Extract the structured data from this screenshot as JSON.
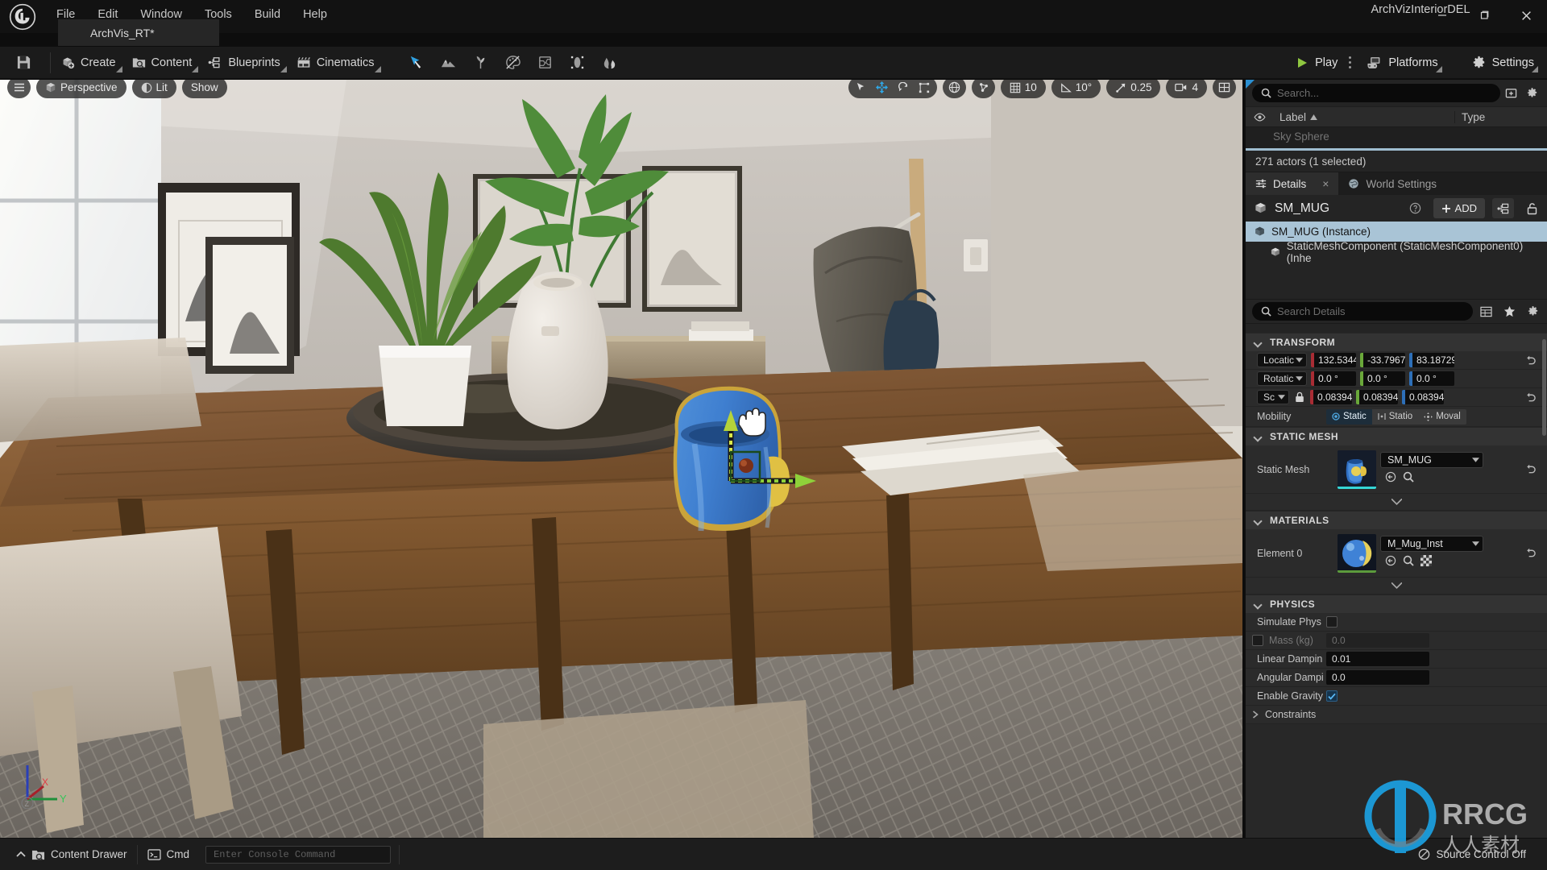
{
  "titlebar": {
    "logo_icon": "unreal-engine-logo",
    "menus": [
      "File",
      "Edit",
      "Window",
      "Tools",
      "Build",
      "Help"
    ],
    "project_tab": "ArchVis_RT*",
    "window_title": "ArchVizInteriorDEL",
    "minimize_icon": "minimize-icon",
    "maximize_icon": "restore-icon",
    "close_icon": "close-icon"
  },
  "toolbar": {
    "save_icon": "save-icon",
    "buttons": [
      {
        "label": "Create",
        "icon": "create-cube-plus-icon"
      },
      {
        "label": "Content",
        "icon": "content-folder-icon"
      },
      {
        "label": "Blueprints",
        "icon": "blueprints-node-icon"
      },
      {
        "label": "Cinematics",
        "icon": "cinematics-clapper-icon"
      }
    ],
    "modes": [
      {
        "name": "select-mode-icon",
        "active": true
      },
      {
        "name": "landscape-mode-icon",
        "active": false
      },
      {
        "name": "foliage-mode-icon",
        "active": false
      },
      {
        "name": "mesh-paint-mode-icon",
        "active": false
      },
      {
        "name": "fracture-mode-icon",
        "active": false
      },
      {
        "name": "brush-edit-mode-icon",
        "active": false
      },
      {
        "name": "animation-mode-icon",
        "active": false
      }
    ],
    "play_label": "Play",
    "play_icon": "play-triangle-icon",
    "platforms_label": "Platforms",
    "platforms_icon": "gamepad-icon",
    "settings_label": "Settings",
    "settings_icon": "gear-icon"
  },
  "viewport": {
    "menu_icon": "hamburger-icon",
    "perspective_label": "Perspective",
    "perspective_icon": "cube-icon",
    "lit_label": "Lit",
    "lit_icon": "lit-sphere-icon",
    "show_label": "Show",
    "gizmos": [
      {
        "name": "select-tool-icon",
        "active": false
      },
      {
        "name": "move-tool-icon",
        "active": true
      },
      {
        "name": "rotate-tool-icon",
        "active": false
      },
      {
        "name": "scale-tool-icon",
        "active": false
      }
    ],
    "coord_icon": "world-coordinate-icon",
    "surface_snap_icon": "surface-snap-icon",
    "grid_snap_value": "10",
    "grid_snap_icon": "grid-icon",
    "angle_snap_value": "10°",
    "angle_snap_icon": "angle-icon",
    "scale_snap_value": "0.25",
    "scale_snap_icon": "scale-arrow-icon",
    "camera_speed_value": "4",
    "camera_speed_icon": "camera-icon",
    "layout_icon": "viewport-layout-icon",
    "axis_gizmo": {
      "x": "X",
      "y": "Y",
      "z": "Z"
    },
    "cursor_icon": "hand-cursor"
  },
  "outliner": {
    "search_placeholder": "Search...",
    "add_icon": "add-folder-icon",
    "settings_icon": "gear-icon",
    "eye_icon": "eye-icon",
    "col_label": "Label",
    "col_type": "Type",
    "sort_icon": "sort-ascending-icon",
    "status": "271 actors (1 selected)"
  },
  "details": {
    "tabs": [
      {
        "label": "Details",
        "icon": "sliders-icon",
        "active": true,
        "closable": true
      },
      {
        "label": "World Settings",
        "icon": "globe-icon",
        "active": false,
        "closable": false
      }
    ],
    "close_icon": "close-icon",
    "actor_name": "SM_MUG",
    "actor_icon": "static-mesh-icon",
    "help_icon": "help-circle-icon",
    "add_label": "ADD",
    "add_icon": "plus-icon",
    "blueprint_icon": "blueprint-node-icon",
    "lock_icon": "unlock-icon",
    "components": [
      {
        "label": "SM_MUG (Instance)",
        "icon": "static-mesh-icon",
        "selected": true,
        "child": false
      },
      {
        "label": "StaticMeshComponent (StaticMeshComponent0) (Inhe",
        "icon": "static-mesh-icon",
        "selected": false,
        "child": true
      }
    ],
    "search_placeholder": "Search Details",
    "search_icon": "search-icon",
    "column_icon": "columns-icon",
    "favorite_icon": "star-icon",
    "gear_icon": "gear-icon",
    "categories": {
      "transform": {
        "title": "TRANSFORM",
        "rows": [
          {
            "label": "Locatic",
            "type": "vector",
            "values": [
              "132.5344",
              "-33.7967",
              "83.18729"
            ],
            "reset": true,
            "locked": false
          },
          {
            "label": "Rotatic",
            "type": "vector",
            "values": [
              "0.0 °",
              "0.0 °",
              "0.0 °"
            ],
            "reset": false,
            "locked": false
          },
          {
            "label": "Sc",
            "type": "vector",
            "values": [
              "0.083942",
              "0.083943",
              "0.083942"
            ],
            "reset": true,
            "locked": true
          }
        ],
        "mobility_label": "Mobility",
        "mobility_options": [
          {
            "label": "Static",
            "icon": "radio-dot-icon",
            "active": true
          },
          {
            "label": "Statio",
            "icon": "stationary-icon",
            "active": false
          },
          {
            "label": "Moval",
            "icon": "movable-icon",
            "active": false
          }
        ]
      },
      "static_mesh": {
        "title": "STATIC MESH",
        "label": "Static Mesh",
        "value": "SM_MUG",
        "thumbnail": "mug-mesh-thumbnail",
        "thumb_bar_color": "#35d6d6",
        "browse_icon": "browse-to-asset-icon",
        "search_icon": "search-icon",
        "reset_icon": "reset-arrow-icon"
      },
      "materials": {
        "title": "MATERIALS",
        "label": "Element 0",
        "value": "M_Mug_Inst",
        "thumbnail": "material-sphere-thumbnail",
        "thumb_bar_color": "#5c9b3c",
        "browse_icon": "browse-to-asset-icon",
        "search_icon": "search-icon",
        "checker_icon": "checker-swatch-icon",
        "reset_icon": "reset-arrow-icon"
      },
      "physics": {
        "title": "PHYSICS",
        "rows": [
          {
            "label": "Simulate Phys",
            "type": "checkbox",
            "checked": false,
            "has_override": false,
            "dim": false
          },
          {
            "label": "Mass (kg)",
            "type": "text",
            "value": "0.0",
            "has_override": true,
            "dim": true
          },
          {
            "label": "Linear Dampin",
            "type": "text",
            "value": "0.01",
            "has_override": false,
            "dim": false
          },
          {
            "label": "Angular Dampi",
            "type": "text",
            "value": "0.0",
            "has_override": false,
            "dim": false
          },
          {
            "label": "Enable Gravity",
            "type": "checkbox",
            "checked": true,
            "has_override": false,
            "dim": false
          }
        ],
        "constraints_label": "Constraints"
      }
    },
    "axis_colors": {
      "x": "#a82c34",
      "y": "#6aa83a",
      "z": "#2d6fb8"
    }
  },
  "statusbar": {
    "content_drawer_label": "Content Drawer",
    "content_drawer_icon": "content-drawer-icon",
    "expand_icon": "chevron-up-icon",
    "cmd_label": "Cmd",
    "cmd_icon": "terminal-icon",
    "console_placeholder": "Enter Console Command",
    "source_control_label": "Source Control Off",
    "source_control_icon": "no-source-control-icon"
  },
  "watermark": {
    "text": "RRCG",
    "subtext": "人人素材",
    "color": "#1ba1e2"
  }
}
